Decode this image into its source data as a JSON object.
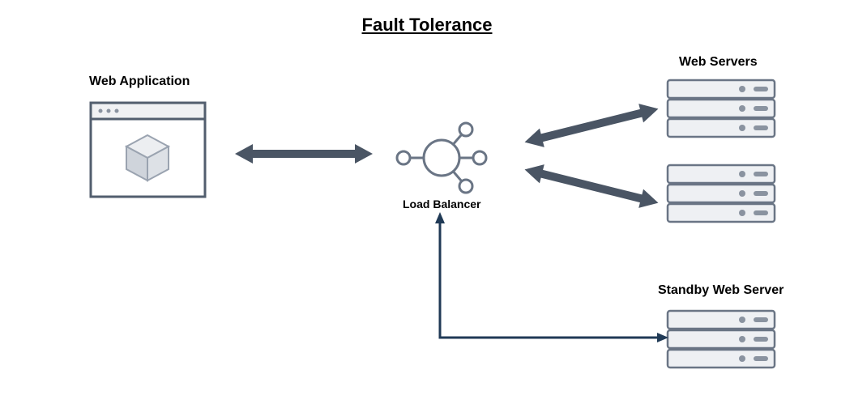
{
  "title": "Fault Tolerance",
  "nodes": {
    "web_app": {
      "label": "Web Application"
    },
    "load_balancer": {
      "label": "Load Balancer"
    },
    "web_servers": {
      "label": "Web Servers"
    },
    "standby": {
      "label": "Standby Web Server"
    }
  },
  "colors": {
    "arrow_thick": "#4a5564",
    "arrow_thin": "#203a56",
    "icon_stroke": "#6a7585",
    "icon_fill": "#d9dde3",
    "window_border": "#525e6e"
  }
}
